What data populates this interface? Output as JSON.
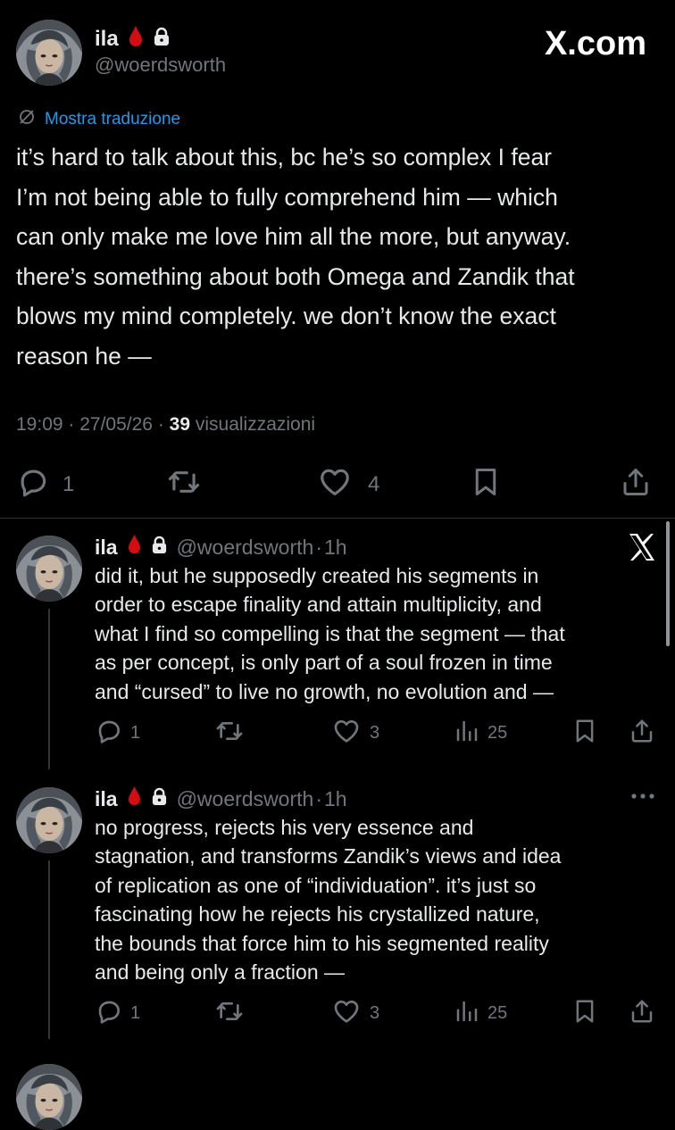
{
  "main_post": {
    "display_name": "ila",
    "handle": "@woerdsworth",
    "brand": "X.com",
    "translate_label": "Mostra traduzione",
    "text": "it’s hard to talk about this, bc he’s so complex I fear\nI’m not being able to fully comprehend him — which\ncan only make me love him all the more, but anyway.\nthere’s something about both Omega and Zandik that\nblows my mind completely. we don’t know the exact\nreason he —",
    "time": "19:09",
    "date": "27/05/26",
    "views_count": "39",
    "views_label": "visualizzazioni",
    "replies": "1",
    "likes": "4"
  },
  "replies": [
    {
      "display_name": "ila",
      "handle": "@woerdsworth",
      "age": "1h",
      "text": "did it, but he supposedly created his segments in\norder to escape finality and attain multiplicity, and\nwhat I find so compelling is that the segment — that\nas per concept, is only part of a soul frozen in time\nand “cursed” to live no growth, no evolution and —",
      "replies": "1",
      "likes": "3",
      "views": "25"
    },
    {
      "display_name": "ila",
      "handle": "@woerdsworth",
      "age": "1h",
      "text": "no progress, rejects his very essence and\nstagnation, and transforms Zandik’s views and idea\nof replication as one of “individuation”. it’s just so\nfascinating how he rejects his crystallized nature,\nthe bounds that force him to his segmented reality\nand being only a fraction —",
      "replies": "1",
      "likes": "3",
      "views": "25"
    }
  ],
  "icons": {
    "blood": "blood-drop-icon",
    "lock": "lock-icon",
    "translate": "translate-icon",
    "reply": "reply-icon",
    "retweet": "retweet-icon",
    "like": "heart-icon",
    "bookmark": "bookmark-icon",
    "share": "share-icon",
    "views": "views-icon",
    "more": "more-icon",
    "x_logo": "x-logo-icon"
  },
  "colors": {
    "background": "#000000",
    "text": "#e7e9ea",
    "muted": "#71767b",
    "link": "#1d9bf0",
    "blood": "#d40d12"
  }
}
